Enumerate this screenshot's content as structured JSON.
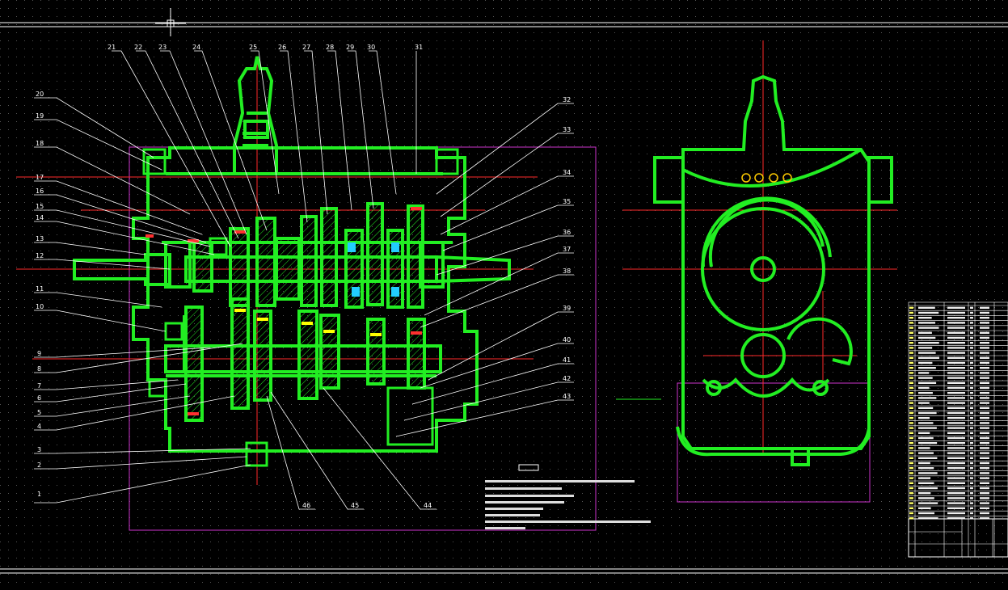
{
  "drawing": {
    "background": "#000000",
    "part_color": "#22ee22",
    "centerline_color": "#ff2a2a",
    "frame_color": "#cc33cc",
    "leader_color": "#ffffff",
    "title_block_color": "#ffffff",
    "highlight_color": "#ffff00"
  },
  "callouts_top": [
    "21",
    "22",
    "23",
    "24",
    "25",
    "26",
    "27",
    "28",
    "29",
    "30",
    "31"
  ],
  "callouts_left": [
    "20",
    "19",
    "18",
    "17",
    "16",
    "15",
    "14",
    "13",
    "12",
    "11",
    "10",
    "9",
    "8",
    "7",
    "6",
    "5",
    "4",
    "3",
    "2",
    "1"
  ],
  "callouts_right": [
    "32",
    "33",
    "34",
    "35",
    "36",
    "37",
    "38",
    "39",
    "40",
    "41",
    "42",
    "43"
  ],
  "callouts_bottom": [
    "46",
    "45",
    "44"
  ]
}
